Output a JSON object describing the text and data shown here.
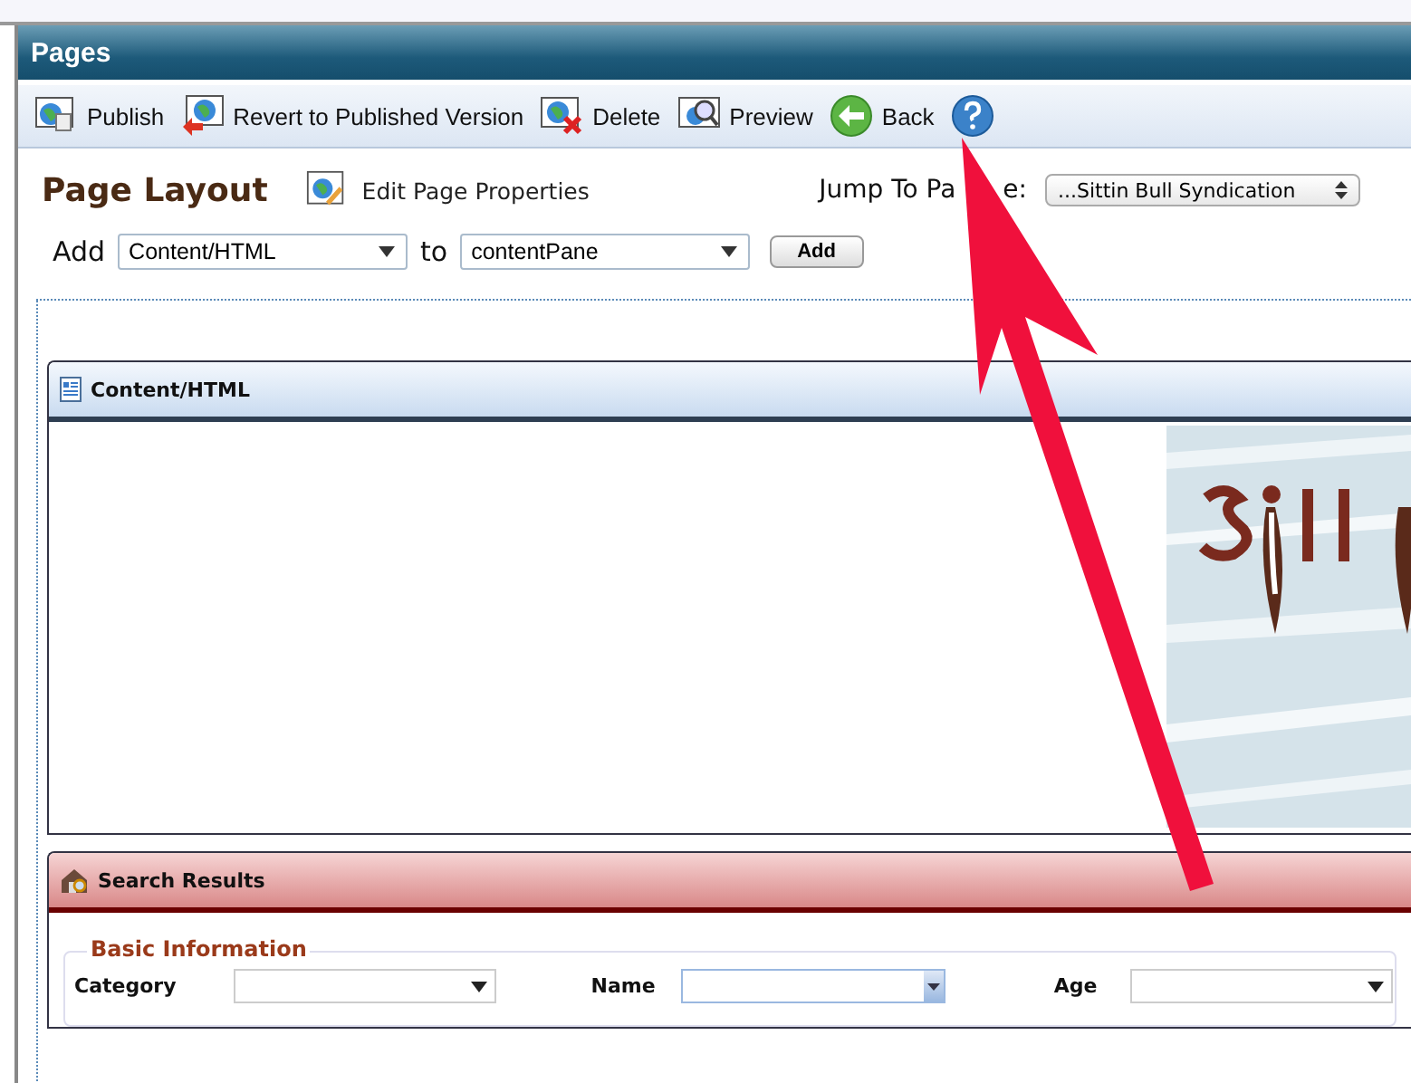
{
  "window": {
    "title": "Pages"
  },
  "toolbar": [
    {
      "label": "Publish",
      "kind": "publish"
    },
    {
      "label": "Revert to Published Version",
      "kind": "revert"
    },
    {
      "label": "Delete",
      "kind": "delete"
    },
    {
      "label": "Preview",
      "kind": "preview"
    },
    {
      "label": "Back",
      "kind": "back"
    },
    {
      "kind": "help"
    }
  ],
  "page_layout": {
    "heading": "Page Layout",
    "edit_link": "Edit Page Properties",
    "jump_label": "Jump To Pa",
    "jump_label_end": "e:",
    "jump_value": "...Sittin Bull Syndication"
  },
  "add_row": {
    "label": "Add",
    "module": "Content/HTML",
    "to_label": "to",
    "pane": "contentPane",
    "button": "Add"
  },
  "modules": [
    {
      "title": "Content/HTML",
      "kind": "content"
    },
    {
      "title": "Search Results",
      "kind": "search"
    }
  ],
  "search_form": {
    "legend": "Basic Information",
    "fields": [
      {
        "label": "Category"
      },
      {
        "label": "Name"
      },
      {
        "label": "Age"
      }
    ]
  }
}
